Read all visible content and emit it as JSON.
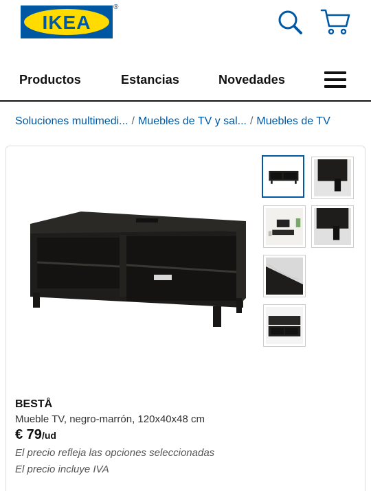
{
  "header": {
    "logo_text": "IKEA",
    "logo_registered": "®",
    "colors": {
      "brand_blue": "#0058a3",
      "brand_yellow": "#ffdb00"
    },
    "search_icon": "search-icon",
    "cart_icon": "cart-icon"
  },
  "nav": {
    "items": [
      {
        "label": "Productos"
      },
      {
        "label": "Estancias"
      },
      {
        "label": "Novedades"
      }
    ],
    "menu_icon": "hamburger-menu-icon"
  },
  "breadcrumb": {
    "items": [
      {
        "label": "Soluciones multimedi..."
      },
      {
        "label": "Muebles de TV y sal..."
      },
      {
        "label": "Muebles de TV"
      }
    ],
    "separator": "/"
  },
  "product": {
    "name": "BESTÅ",
    "description": "Mueble TV, negro-marrón, 120x40x48 cm",
    "price": "€ 79",
    "price_unit": "/ud",
    "note_options": "El precio refleja las opciones seleccionadas",
    "note_vat": "El precio incluye IVA",
    "main_image": "tv-bench-image",
    "thumbnails": [
      {
        "name": "thumb-tv-bench-front",
        "selected": true
      },
      {
        "name": "thumb-leg-detail-1",
        "selected": false
      },
      {
        "name": "thumb-room-scene",
        "selected": false
      },
      {
        "name": "thumb-leg-detail-2",
        "selected": false
      },
      {
        "name": "thumb-cable-management",
        "selected": false
      },
      {
        "name": "thumb-bench-with-tv",
        "selected": false
      }
    ]
  }
}
